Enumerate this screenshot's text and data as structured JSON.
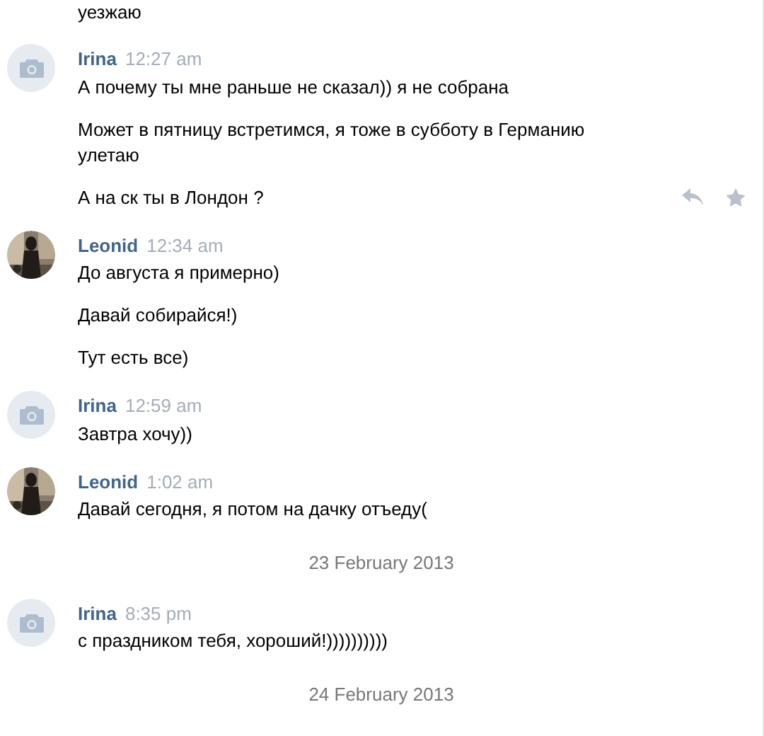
{
  "items": [
    {
      "kind": "continuation",
      "lines": [
        {
          "text": "уезжаю",
          "hovered": false
        }
      ]
    },
    {
      "kind": "message",
      "author": "Irina",
      "avatar": {
        "kind": "camera"
      },
      "time": "12:27 am",
      "lines": [
        {
          "text": "А почему ты мне раньше не сказал)) я не собрана",
          "hovered": false
        },
        {
          "text": "Может в пятницу встретимся, я тоже в субботу в Германию улетаю",
          "hovered": false
        },
        {
          "text": "А на ск ты в Лондон ?",
          "hovered": true
        }
      ]
    },
    {
      "kind": "message",
      "author": "Leonid",
      "time": "12:34 am",
      "lines": [
        {
          "text": "До августа я примерно)",
          "hovered": false
        },
        {
          "text": "Давай собирайся!)",
          "hovered": false
        },
        {
          "text": "Тут есть все)",
          "hovered": false
        }
      ]
    },
    {
      "kind": "message",
      "author": "Irina",
      "avatar": {
        "kind": "camera"
      },
      "time": "12:59 am",
      "lines": [
        {
          "text": "Завтра хочу))",
          "hovered": false
        }
      ]
    },
    {
      "kind": "message",
      "author": "Leonid",
      "time": "1:02 am",
      "lines": [
        {
          "text": "Давай сегодня, я потом на дачку отъеду(",
          "hovered": false
        }
      ]
    },
    {
      "kind": "date",
      "text": "23 February 2013"
    },
    {
      "kind": "message",
      "author": "Irina",
      "avatar": {
        "kind": "camera"
      },
      "time": "8:35 pm",
      "lines": [
        {
          "text": "с праздником тебя, хороший!))))))))))",
          "hovered": false
        }
      ]
    },
    {
      "kind": "date",
      "text": "24 February 2013"
    }
  ]
}
